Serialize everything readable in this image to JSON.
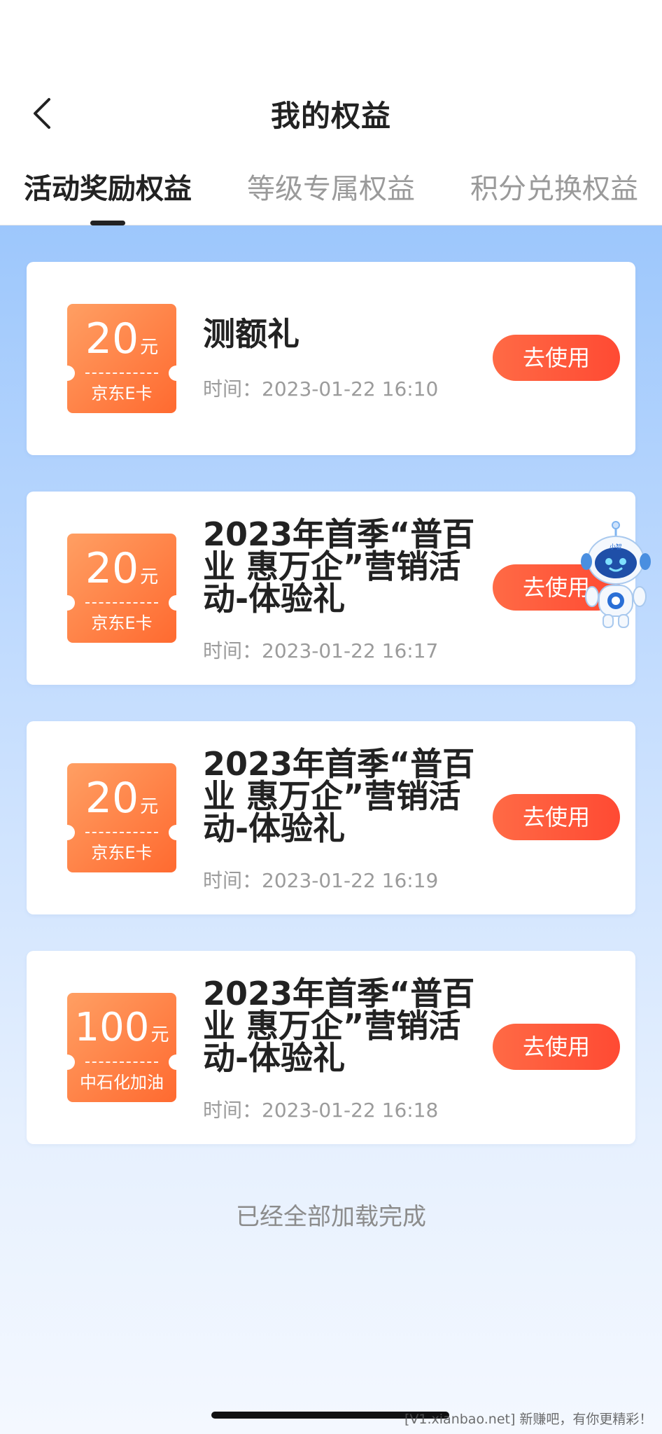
{
  "header": {
    "title": "我的权益",
    "back_icon": "chevron-left-icon"
  },
  "tabs": [
    {
      "label": "活动奖励权益",
      "active": true
    },
    {
      "label": "等级专属权益",
      "active": false
    },
    {
      "label": "积分兑换权益",
      "active": false
    }
  ],
  "cards": [
    {
      "amount": "20",
      "unit": "元",
      "coupon_type": "京东E卡",
      "title": "测额礼",
      "time": "时间：2023-01-22 16:10",
      "button": "去使用"
    },
    {
      "amount": "20",
      "unit": "元",
      "coupon_type": "京东E卡",
      "title": "2023年首季“普百业 惠万企”营销活动-体验礼",
      "time": "时间：2023-01-22 16:17",
      "button": "去使用"
    },
    {
      "amount": "20",
      "unit": "元",
      "coupon_type": "京东E卡",
      "title": "2023年首季“普百业 惠万企”营销活动-体验礼",
      "time": "时间：2023-01-22 16:19",
      "button": "去使用"
    },
    {
      "amount": "100",
      "unit": "元",
      "coupon_type": "中石化加油",
      "title": "2023年首季“普百业 惠万企”营销活动-体验礼",
      "time": "时间：2023-01-22 16:18",
      "button": "去使用"
    }
  ],
  "footer": {
    "status": "已经全部加载完成"
  },
  "assistant": {
    "label": "小智",
    "icon": "robot-assistant-icon"
  },
  "watermark": "[V1.xianbao.net] 新赚吧，有你更精彩！",
  "colors": {
    "accent": "#ff5a3a",
    "coupon_gradient_start": "#ff9f63",
    "coupon_gradient_end": "#ff6a30",
    "background_top": "#9dc7fc"
  }
}
